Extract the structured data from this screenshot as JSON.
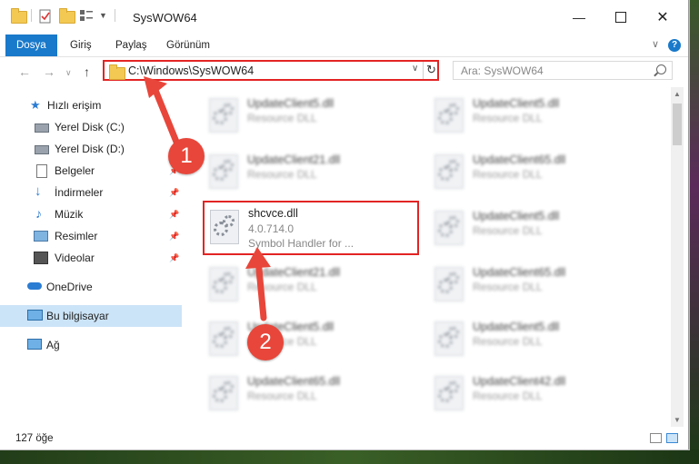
{
  "window": {
    "title": "SysWOW64"
  },
  "ribbon": {
    "tabs": [
      "Dosya",
      "Giriş",
      "Paylaş",
      "Görünüm"
    ],
    "help": "?"
  },
  "address": {
    "path": "C:\\Windows\\SysWOW64"
  },
  "search": {
    "placeholder": "Ara: SysWOW64"
  },
  "sidebar": {
    "items": [
      {
        "label": "Hızlı erişim",
        "icon": "star-icon"
      },
      {
        "label": "Yerel Disk (C:)",
        "icon": "drive-icon"
      },
      {
        "label": "Yerel Disk (D:)",
        "icon": "drive-icon"
      },
      {
        "label": "Belgeler",
        "icon": "documents-icon"
      },
      {
        "label": "İndirmeler",
        "icon": "download-icon"
      },
      {
        "label": "Müzik",
        "icon": "music-icon"
      },
      {
        "label": "Resimler",
        "icon": "pictures-icon"
      },
      {
        "label": "Videolar",
        "icon": "videos-icon"
      },
      {
        "label": "OneDrive",
        "icon": "cloud-icon"
      },
      {
        "label": "Bu bilgisayar",
        "icon": "computer-icon"
      },
      {
        "label": "Ağ",
        "icon": "network-icon"
      }
    ]
  },
  "files": {
    "left": [
      {
        "name": "UpdateClient5.dll",
        "sub": "Resource DLL"
      },
      {
        "name": "UpdateClient21.dll",
        "sub": "Resource DLL"
      },
      {
        "name": "shcvce.dll",
        "version": "4.0.714.0",
        "desc": "Symbol Handler for ..."
      },
      {
        "name": "UpdateClient21.dll",
        "sub": "Resource DLL"
      },
      {
        "name": "UpdateClient5.dll",
        "sub": "Resource DLL"
      },
      {
        "name": "UpdateClient65.dll",
        "sub": "Resource DLL"
      }
    ],
    "right": [
      {
        "name": "UpdateClient5.dll",
        "sub": "Resource DLL"
      },
      {
        "name": "UpdateClient65.dll",
        "sub": "Resource DLL"
      },
      {
        "name": "UpdateClient5.dll",
        "sub": "Resource DLL"
      },
      {
        "name": "UpdateClient65.dll",
        "sub": "Resource DLL"
      },
      {
        "name": "UpdateClient5.dll",
        "sub": "Resource DLL"
      },
      {
        "name": "UpdateClient42.dll",
        "sub": "Resource DLL"
      }
    ]
  },
  "status": {
    "count": "127 öğe"
  },
  "annotations": {
    "badge1": "1",
    "badge2": "2",
    "color": "#e8463a"
  }
}
